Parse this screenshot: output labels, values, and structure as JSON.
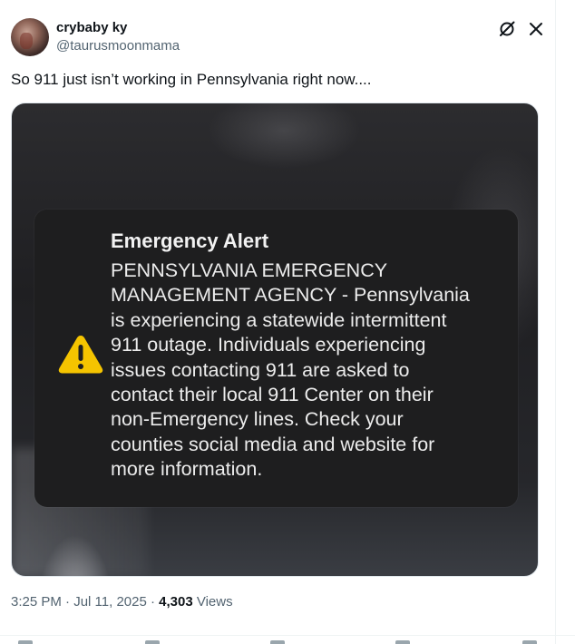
{
  "author": {
    "display_name": "crybaby ky",
    "handle": "@taurusmoonmama"
  },
  "tweet": {
    "text": "So 911 just isn’t working in Pennsylvania right now...."
  },
  "alert": {
    "title": "Emergency Alert",
    "body": "PENNSYLVANIA EMERGENCY\nMANAGEMENT AGENCY - Pennsylvania\nis experiencing a statewide intermittent\n911 outage.  Individuals experiencing\nissues contacting 911 are asked to\ncontact their local 911 Center on their\nnon-Emergency lines.  Check your\ncounties social media and website for\nmore information."
  },
  "meta": {
    "timestamp": "3:25 PM · Jul 11, 2025",
    "separator": " · ",
    "views_count": "4,303",
    "views_label": " Views"
  },
  "colors": {
    "warning": "#f5c400",
    "muted_text": "#536471"
  },
  "icons": {
    "grok": "grok-icon",
    "more": "more-icon",
    "warning": "warning-triangle-icon"
  }
}
